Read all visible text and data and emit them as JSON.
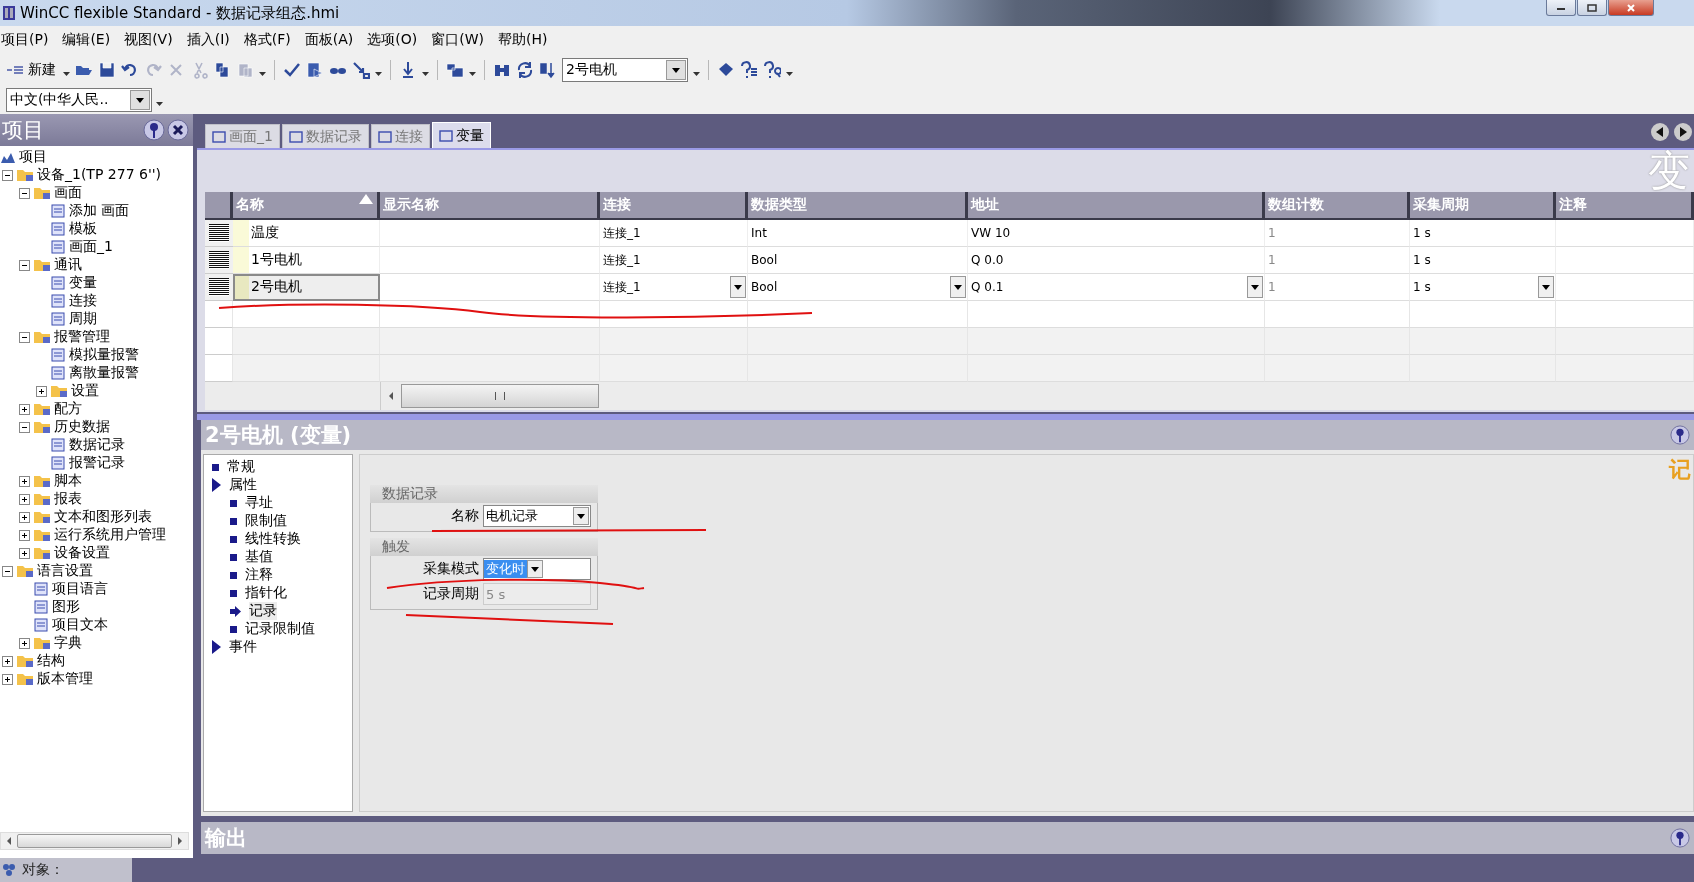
{
  "window": {
    "title": "WinCC flexible Standard - 数据记录组态.hmi"
  },
  "menu": [
    "项目(P)",
    "编辑(E)",
    "视图(V)",
    "插入(I)",
    "格式(F)",
    "面板(A)",
    "选项(O)",
    "窗口(W)",
    "帮助(H)"
  ],
  "toolbar": {
    "new_label": "新建",
    "object_combo": "2号电机"
  },
  "language_combo": "中文(中华人民..",
  "project_pane": {
    "title": "项目",
    "tree": {
      "label": "项目",
      "children": [
        {
          "label": "设备_1(TP 277 6'')",
          "expanded": true,
          "children": [
            {
              "label": "画面",
              "expanded": true,
              "children": [
                {
                  "label": "添加 画面"
                },
                {
                  "label": "模板"
                },
                {
                  "label": "画面_1"
                }
              ]
            },
            {
              "label": "通讯",
              "expanded": true,
              "children": [
                {
                  "label": "变量"
                },
                {
                  "label": "连接"
                },
                {
                  "label": "周期"
                }
              ]
            },
            {
              "label": "报警管理",
              "expanded": true,
              "children": [
                {
                  "label": "模拟量报警"
                },
                {
                  "label": "离散量报警"
                },
                {
                  "label": "设置",
                  "expanded": false
                }
              ]
            },
            {
              "label": "配方",
              "expanded": false
            },
            {
              "label": "历史数据",
              "expanded": true,
              "children": [
                {
                  "label": "数据记录"
                },
                {
                  "label": "报警记录"
                }
              ]
            },
            {
              "label": "脚本",
              "expanded": false
            },
            {
              "label": "报表",
              "expanded": false
            },
            {
              "label": "文本和图形列表",
              "expanded": false
            },
            {
              "label": "运行系统用户管理",
              "expanded": false
            },
            {
              "label": "设备设置",
              "expanded": false
            }
          ]
        },
        {
          "label": "语言设置",
          "expanded": true,
          "children": [
            {
              "label": "项目语言"
            },
            {
              "label": "图形"
            },
            {
              "label": "项目文本"
            },
            {
              "label": "字典",
              "expanded": false
            }
          ]
        },
        {
          "label": "结构",
          "expanded": false
        },
        {
          "label": "版本管理",
          "expanded": false
        }
      ]
    }
  },
  "tabs": [
    {
      "label": "画面_1",
      "selected": false
    },
    {
      "label": "数据记录",
      "selected": false
    },
    {
      "label": "连接",
      "selected": false
    },
    {
      "label": "变量",
      "selected": true
    }
  ],
  "editor": {
    "title": "变",
    "table": {
      "columns": [
        {
          "label": "名称",
          "sorted": true
        },
        {
          "label": "显示名称"
        },
        {
          "label": "连接",
          "dropdown": true
        },
        {
          "label": "数据类型",
          "dropdown": true
        },
        {
          "label": "地址",
          "dropdown": true
        },
        {
          "label": "数组计数",
          "readonly": true
        },
        {
          "label": "采集周期",
          "dropdown": true
        },
        {
          "label": "注释"
        }
      ],
      "rows": [
        {
          "name": "温度",
          "connection": "连接_1",
          "data_type": "Int",
          "address": "VW 10",
          "array_count": "1",
          "acquisition_cycle": "1 s",
          "selected": false
        },
        {
          "name": "1号电机",
          "connection": "连接_1",
          "data_type": "Bool",
          "address": "Q 0.0",
          "array_count": "1",
          "acquisition_cycle": "1 s",
          "selected": false
        },
        {
          "name": "2号电机",
          "connection": "连接_1",
          "data_type": "Bool",
          "address": "Q 0.1",
          "array_count": "1",
          "acquisition_cycle": "1 s",
          "selected": true
        }
      ]
    }
  },
  "properties": {
    "title": "2号电机 (变量)",
    "side_title": "记",
    "nav": [
      {
        "label": "常规",
        "kind": "page",
        "selected": false
      },
      {
        "label": "属性",
        "kind": "section",
        "selected": false,
        "children": [
          {
            "label": "寻址",
            "kind": "page",
            "selected": false
          },
          {
            "label": "限制值",
            "kind": "page",
            "selected": false
          },
          {
            "label": "线性转换",
            "kind": "page",
            "selected": false
          },
          {
            "label": "基值",
            "kind": "page",
            "selected": false
          },
          {
            "label": "注释",
            "kind": "page",
            "selected": false
          },
          {
            "label": "指针化",
            "kind": "page",
            "selected": false
          },
          {
            "label": "记录",
            "kind": "page",
            "selected": true
          },
          {
            "label": "记录限制值",
            "kind": "page",
            "selected": false
          }
        ]
      },
      {
        "label": "事件",
        "kind": "section",
        "selected": false
      }
    ],
    "groups": [
      {
        "title": "数据记录",
        "fields": [
          {
            "label": "名称",
            "kind": "dropdown",
            "value": "电机记录",
            "highlighted": false,
            "disabled": false
          }
        ]
      },
      {
        "title": "触发",
        "fields": [
          {
            "label": "采集模式",
            "kind": "dropdown",
            "value": "变化时",
            "highlighted": true,
            "disabled": false
          },
          {
            "label": "记录周期",
            "kind": "text",
            "value": "5 s",
            "highlighted": false,
            "disabled": true
          }
        ]
      }
    ]
  },
  "output_pane": {
    "title": "输出"
  },
  "status_bar": {
    "label": "对象："
  }
}
